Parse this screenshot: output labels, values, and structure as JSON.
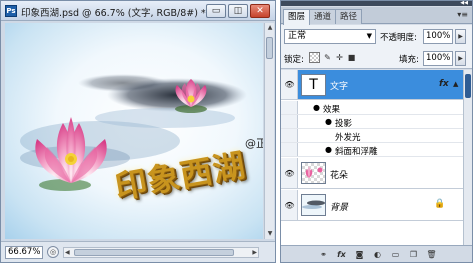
{
  "document": {
    "logo": "Ps",
    "title": "印象西湖.psd @ 66.7% (文字, RGB/8#) *",
    "controls": {
      "minimize": "▭",
      "restore": "◫",
      "close": "✕"
    },
    "canvas": {
      "calligraphy": "印象西湖",
      "watermark": "@正确教育"
    },
    "status": {
      "zoom": "66.67%"
    }
  },
  "layers_panel": {
    "tabs": [
      {
        "label": "图层",
        "active": true
      },
      {
        "label": "通道",
        "active": false
      },
      {
        "label": "路径",
        "active": false
      }
    ],
    "blend_mode": "正常",
    "opacity_label": "不透明度:",
    "opacity_value": "100%",
    "lock_label": "锁定:",
    "fill_label": "填充:",
    "fill_value": "100%",
    "layers": [
      {
        "name": "文字",
        "selected": true,
        "has_fx": true,
        "fx_label": "fx"
      },
      {
        "name": "花朵",
        "selected": false
      },
      {
        "name": "背景",
        "selected": false,
        "locked": true
      }
    ],
    "effects": {
      "group_label": "效果",
      "items": [
        "投影",
        "外发光",
        "斜面和浮雕"
      ]
    }
  },
  "colors": {
    "selection": "#3b8ddd",
    "lotus_pink": "#e8609f",
    "lotus_center": "#f5d238",
    "calligraphy_gold": "#c8941e"
  }
}
